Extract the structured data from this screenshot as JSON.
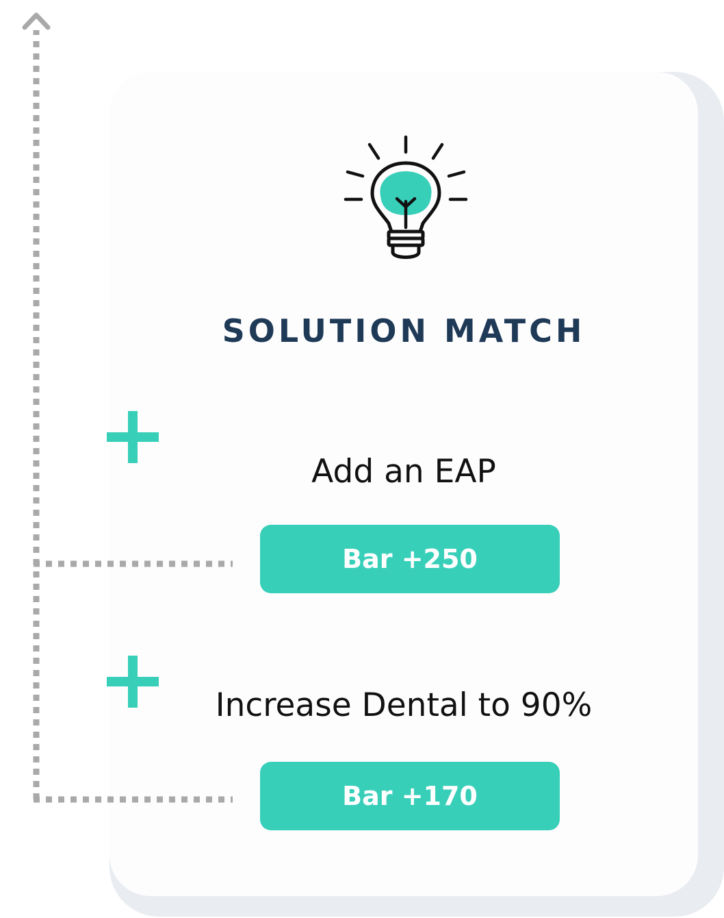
{
  "title": "SOLUTION MATCH",
  "icon": "lightbulb-icon",
  "colors": {
    "accent": "#38cfb9",
    "title": "#1f3a57",
    "connector": "#a9a9a9",
    "card_shadow": "#e9ecf1"
  },
  "items": [
    {
      "icon": "plus-icon",
      "label": "Add an EAP",
      "button": "Bar +250"
    },
    {
      "icon": "plus-icon",
      "label": "Increase Dental to 90%",
      "button": "Bar +170"
    }
  ],
  "connector_icon": "arrow-up-icon"
}
